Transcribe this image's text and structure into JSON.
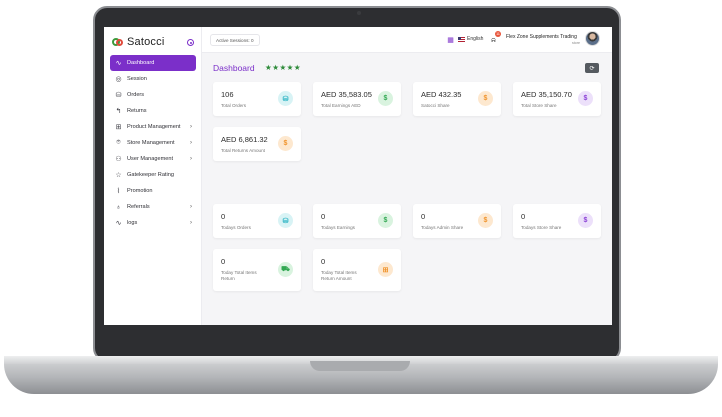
{
  "brand": {
    "name": "Satocci"
  },
  "sidebar": {
    "items": [
      {
        "label": "Dashboard",
        "icon": "activity-icon",
        "active": true,
        "has_submenu": false
      },
      {
        "label": "Session",
        "icon": "globe-icon",
        "active": false,
        "has_submenu": false
      },
      {
        "label": "Orders",
        "icon": "database-icon",
        "active": false,
        "has_submenu": false
      },
      {
        "label": "Returns",
        "icon": "return-arrow-icon",
        "active": false,
        "has_submenu": false
      },
      {
        "label": "Product Management",
        "icon": "gift-icon",
        "active": false,
        "has_submenu": true
      },
      {
        "label": "Store Management",
        "icon": "location-pin-icon",
        "active": false,
        "has_submenu": true
      },
      {
        "label": "User Management",
        "icon": "users-icon",
        "active": false,
        "has_submenu": true
      },
      {
        "label": "Gatekeeper Rating",
        "icon": "star-icon",
        "active": false,
        "has_submenu": false
      },
      {
        "label": "Promotion",
        "icon": "rss-icon",
        "active": false,
        "has_submenu": false
      },
      {
        "label": "Referrals",
        "icon": "award-icon",
        "active": false,
        "has_submenu": true
      },
      {
        "label": "logs",
        "icon": "pulse-icon",
        "active": false,
        "has_submenu": true
      }
    ],
    "chevron": "›"
  },
  "topbar": {
    "sessions_label": "Active Sessions: 0",
    "language": "English",
    "notification_count": "11",
    "user_name": "Flex Zone Supplements Trading",
    "user_role": "store"
  },
  "page": {
    "title": "Dashboard",
    "stars": "★★★★★",
    "refresh_icon": "⟳"
  },
  "stats": [
    {
      "value": "106",
      "label": "Total Orders",
      "icon": "database-icon",
      "color": "teal"
    },
    {
      "value": "AED 35,583.05",
      "label": "Total Earnings AED",
      "icon": "dollar-icon",
      "color": "green"
    },
    {
      "value": "AED 432.35",
      "label": "Satocci Share",
      "icon": "dollar-icon",
      "color": "orange"
    },
    {
      "value": "AED 35,150.70",
      "label": "Total Store Share",
      "icon": "dollar-icon",
      "color": "purple"
    },
    {
      "value": "AED 6,861.32",
      "label": "Total Returns Amount",
      "icon": "dollar-icon",
      "color": "orange"
    }
  ],
  "today_stats": [
    {
      "value": "0",
      "label": "Todays Orders",
      "icon": "database-icon",
      "color": "teal"
    },
    {
      "value": "0",
      "label": "Todays Earnings",
      "icon": "dollar-icon",
      "color": "green"
    },
    {
      "value": "0",
      "label": "Todays Admin Share",
      "icon": "dollar-icon",
      "color": "orange"
    },
    {
      "value": "0",
      "label": "Todays Store Share",
      "icon": "dollar-icon",
      "color": "purple"
    },
    {
      "value": "0",
      "label": "Today Total Items Return",
      "icon": "truck-icon",
      "color": "green"
    },
    {
      "value": "0",
      "label": "Today Total Items Return Amount",
      "icon": "gift-icon",
      "color": "orange"
    }
  ]
}
